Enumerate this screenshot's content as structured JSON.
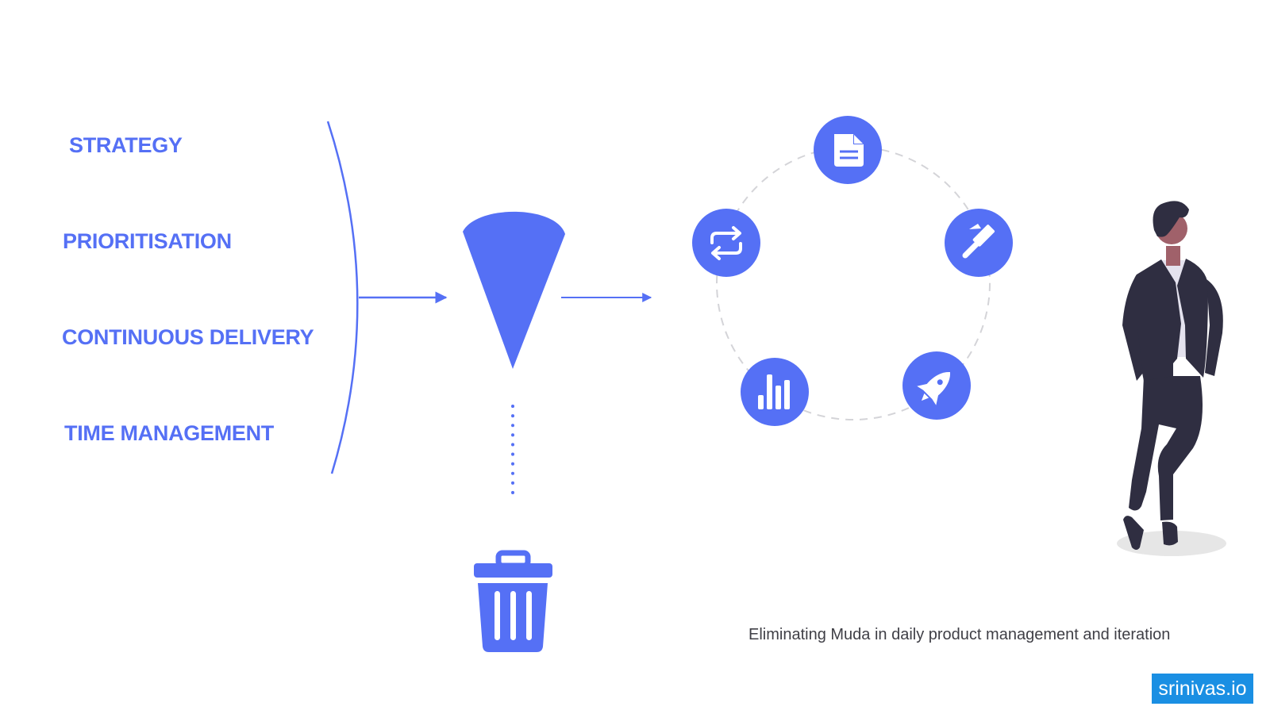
{
  "inputs": [
    {
      "label": "STRATEGY"
    },
    {
      "label": "PRIORITISATION"
    },
    {
      "label": "CONTINUOUS DELIVERY"
    },
    {
      "label": "TIME MANAGEMENT"
    }
  ],
  "funnel": {
    "output": "waste-bin",
    "waste_icon": "trash-icon"
  },
  "cycle": {
    "nodes": [
      {
        "icon": "document-icon"
      },
      {
        "icon": "hammer-icon"
      },
      {
        "icon": "rocket-icon"
      },
      {
        "icon": "bar-chart-icon"
      },
      {
        "icon": "repeat-icon"
      }
    ]
  },
  "caption": "Eliminating Muda in daily product management and iteration",
  "brand": "srinivas.io",
  "colors": {
    "accent": "#5570f5",
    "brand_bg": "#1a8fe3",
    "caption": "#3f3f46",
    "suit": "#2f2e41",
    "skin": "#a0616a"
  }
}
